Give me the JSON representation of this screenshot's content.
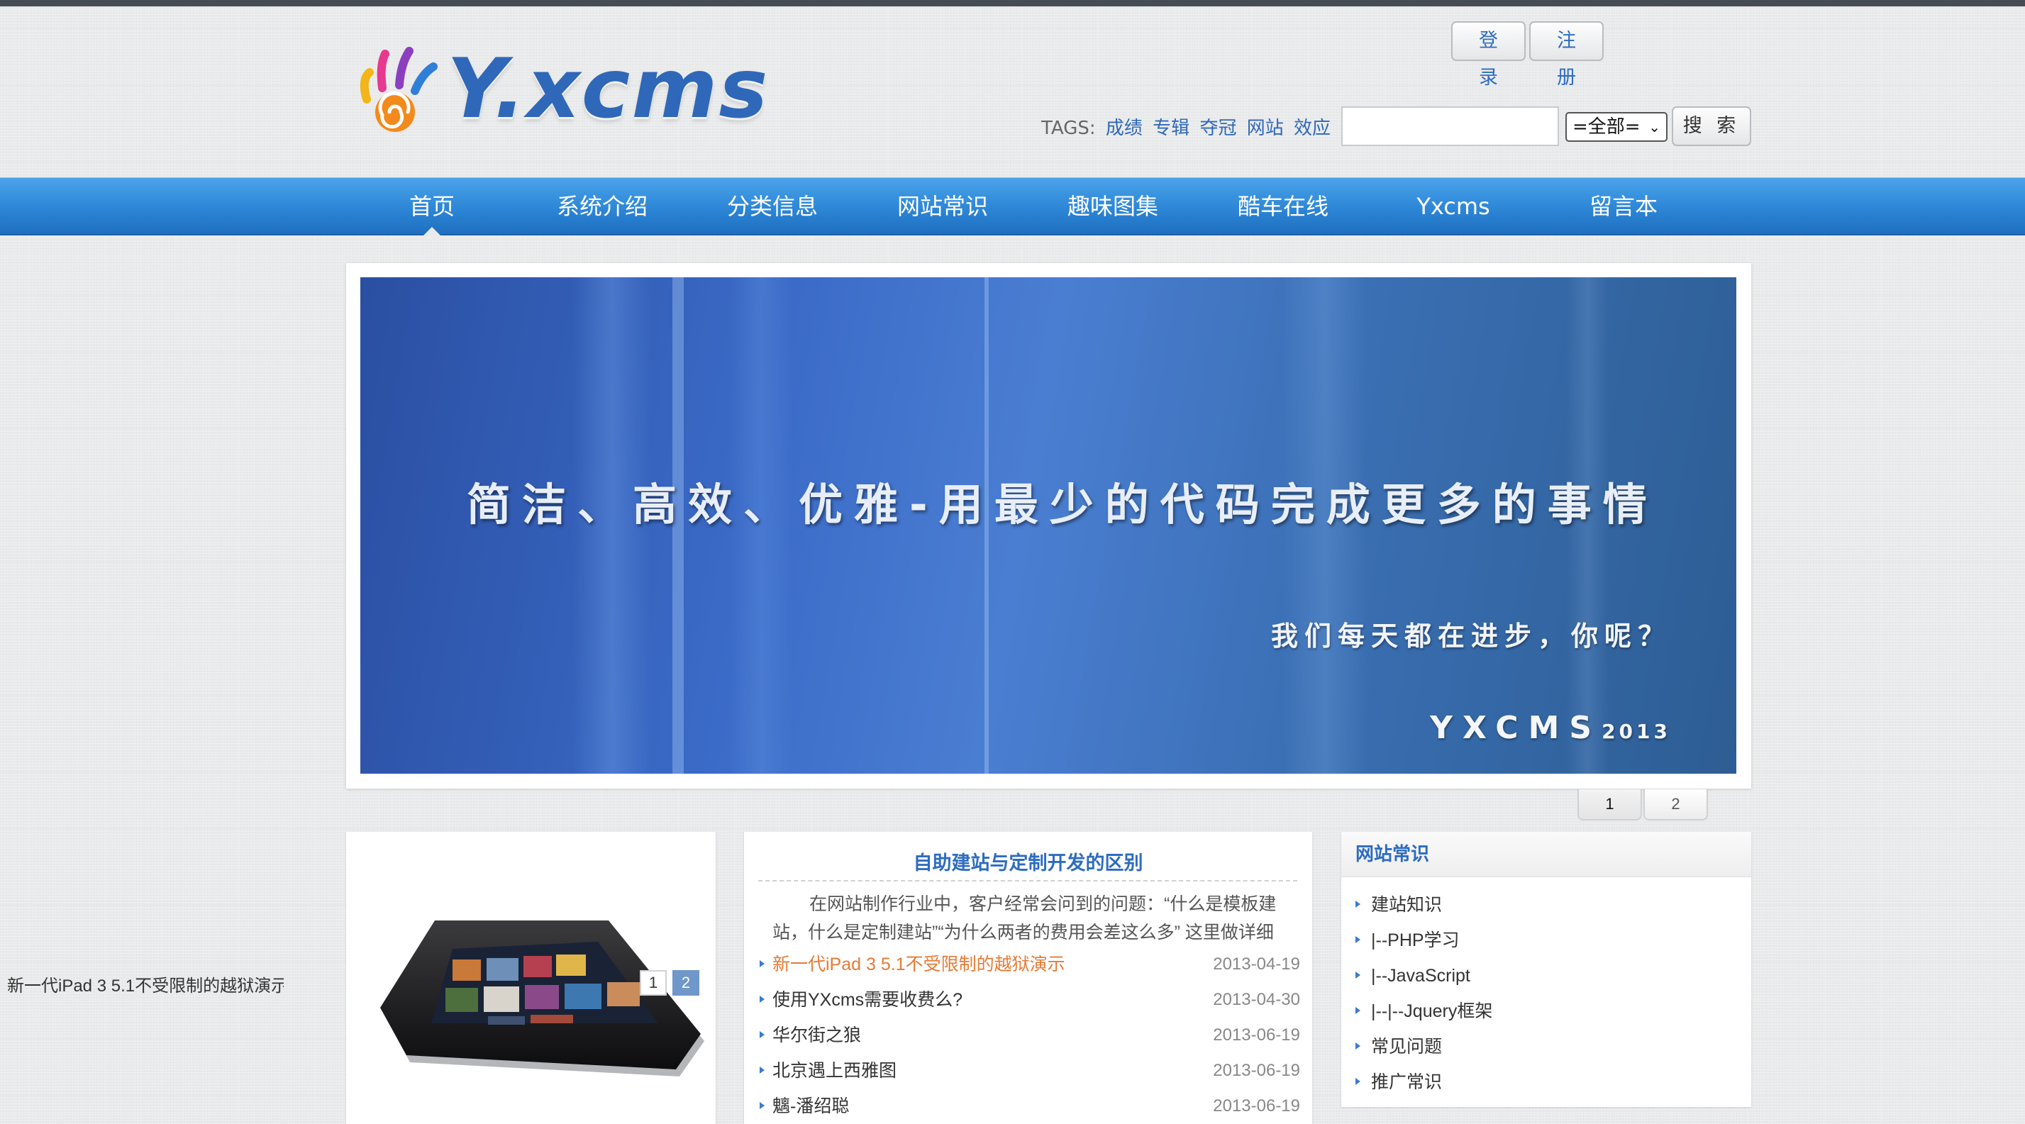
{
  "header": {
    "logo_text": "Y.xcms",
    "login_label": "登录",
    "register_label": "注册",
    "tags_label": "TAGS:",
    "tags": [
      "成绩",
      "专辑",
      "夺冠",
      "网站",
      "效应"
    ],
    "tags_more": "...",
    "search": {
      "value": "",
      "select_value": "=全部=",
      "button_label": "搜 索"
    }
  },
  "nav": {
    "items": [
      {
        "label": "首页"
      },
      {
        "label": "系统介绍"
      },
      {
        "label": "分类信息"
      },
      {
        "label": "网站常识"
      },
      {
        "label": "趣味图集"
      },
      {
        "label": "酷车在线"
      },
      {
        "label": "Yxcms"
      },
      {
        "label": "留言本"
      }
    ],
    "active_index": 0
  },
  "banner": {
    "headline": "简洁、高效、优雅-用最少的代码完成更多的事情",
    "subline": "我们每天都在进步，你呢？",
    "brand": "YXCMS",
    "brand_year": "2013",
    "pager": [
      "1",
      "2"
    ],
    "active_slide": 0
  },
  "left_panel": {
    "caption": "新一代iPad 3 5.1不受限制的越狱演示",
    "pager": [
      "1",
      "2"
    ],
    "active_page": 1
  },
  "mid_panel": {
    "title": "自助建站与定制开发的区别",
    "description": "在网站制作行业中，客户经常会问到的问题：“什么是模板建站，什么是定制建站”“为什么两者的费用会差这么多” 这里做详细的说明",
    "items": [
      {
        "title": "新一代iPad 3 5.1不受限制的越狱演示",
        "date": "2013-04-19",
        "highlight": true
      },
      {
        "title": "使用YXcms需要收费么?",
        "date": "2013-04-30",
        "highlight": false
      },
      {
        "title": "华尔街之狼",
        "date": "2013-06-19",
        "highlight": false
      },
      {
        "title": "北京遇上西雅图",
        "date": "2013-06-19",
        "highlight": false
      },
      {
        "title": "魑-潘绍聪",
        "date": "2013-06-19",
        "highlight": false
      }
    ]
  },
  "right_panel": {
    "title": "网站常识",
    "items": [
      "建站知识",
      "|--PHP学习",
      "|--JavaScript",
      "|--|--Jquery框架",
      "常见问题",
      "推广常识"
    ]
  },
  "colors": {
    "accent": "#2d6cc0",
    "nav_blue": "#2d86d6",
    "highlight_orange": "#e67a34",
    "top_bar": "#454c54"
  }
}
